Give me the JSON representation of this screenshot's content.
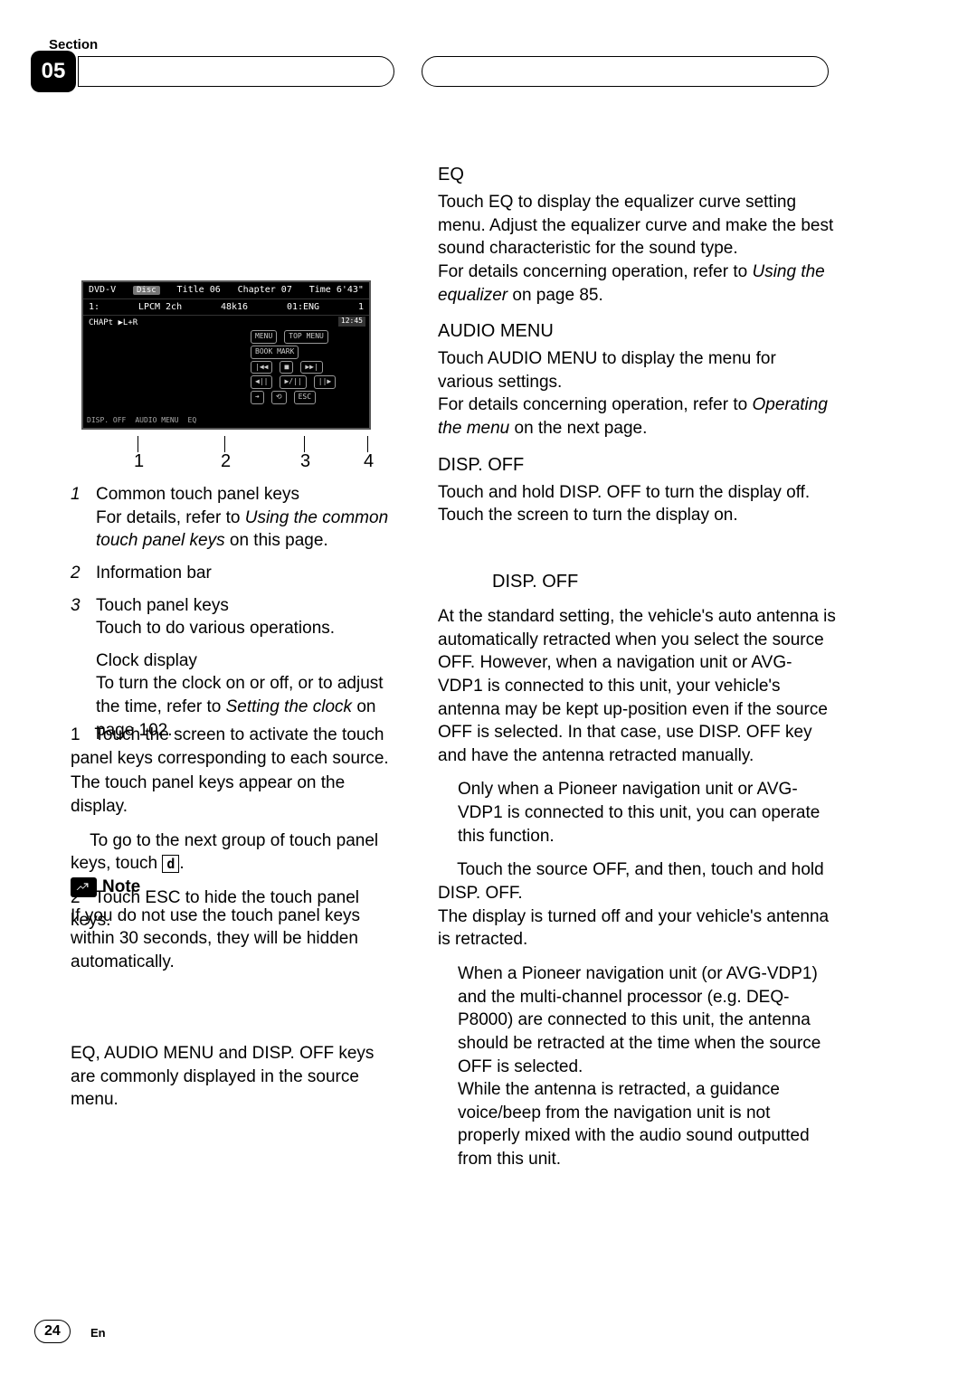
{
  "header": {
    "section_label": "Section",
    "section_number": "05"
  },
  "screenshot": {
    "top": {
      "disc_label": "Disc",
      "title_label": "Title",
      "title_val": "06",
      "chapter_label": "Chapter",
      "chapter_val": "07",
      "time_label": "Time",
      "time_val": "6'43\"",
      "dvd": "DVD-V",
      "audio_icon": "1:",
      "lpcm": "LPCM 2ch",
      "khz": "48k16",
      "sub": "01:ENG",
      "angle": "1"
    },
    "mid_label": "CHAPt ▶L+R",
    "clock": "12:45",
    "buttons": {
      "menu": "MENU",
      "topmenu": "TOP MENU",
      "bookmark": "BOOK MARK",
      "prev": "|◀◀",
      "stop": "■",
      "next": "▶▶|",
      "rew": "◀||",
      "playpause": "▶/||",
      "fwd": "||▶",
      "arrow": "➔",
      "return": "⟲",
      "esc": "ESC"
    },
    "bottom": {
      "disp_off": "DISP. OFF",
      "audio_menu": "AUDIO MENU",
      "eq": "EQ"
    }
  },
  "callouts": {
    "c1": "1",
    "c2": "2",
    "c3": "3",
    "c4": "4"
  },
  "left": {
    "items": [
      {
        "num": "1",
        "lead": "Common touch panel keys",
        "detail_prefix": "For details, refer to ",
        "detail_em": "Using the common touch panel keys",
        "detail_suffix": " on this page."
      },
      {
        "num": "2",
        "lead": "Information bar"
      },
      {
        "num": "3",
        "lead": "Touch panel keys",
        "detail": "Touch to do various operations."
      }
    ],
    "clock_item": {
      "lead": "Clock display",
      "detail_prefix": "To turn the clock on or off, or to adjust the time, refer to ",
      "detail_em": "Setting the clock",
      "detail_suffix": " on page 102."
    },
    "step1": {
      "num": "1",
      "text": "Touch the screen to activate the touch panel keys corresponding to each source."
    },
    "step1_extra": "The touch panel keys appear on the display.",
    "step1_sub_prefix": "To go to the next group of touch panel keys, touch ",
    "step1_sub_key": "d",
    "step1_sub_suffix": ".",
    "step2": {
      "num": "2",
      "text": "Touch ESC to hide the touch panel keys."
    },
    "note_label": "Note",
    "note_text": "If you do not use the touch panel keys within 30 seconds, they will be hidden automatically.",
    "common_keys_text": "EQ, AUDIO MENU and DISP. OFF keys are commonly displayed in the source menu."
  },
  "right": {
    "eq": {
      "title": "EQ",
      "body": "Touch EQ to display the equalizer curve setting menu. Adjust the equalizer curve and make the best sound characteristic for the sound type.",
      "ref_prefix": "For details concerning operation, refer to ",
      "ref_em": "Using the equalizer",
      "ref_suffix": " on page 85."
    },
    "audio_menu": {
      "title": "AUDIO MENU",
      "body": "Touch AUDIO MENU to display the menu for various settings.",
      "ref_prefix": "For details concerning operation, refer to ",
      "ref_em": "Operating the menu",
      "ref_suffix": " on the next page."
    },
    "disp_off": {
      "title": "DISP. OFF",
      "body": "Touch and hold DISP. OFF to turn the display off. Touch the screen to turn the display on."
    },
    "sub_heading": "DISP. OFF",
    "antenna_para": "At the standard setting, the vehicle's auto antenna is automatically retracted when you select the source OFF. However, when a navigation unit or AVG-VDP1 is connected to this unit, your vehicle's antenna may be kept up-position even if the source OFF is selected. In that case, use DISP. OFF key and have the antenna retracted manually.",
    "antenna_bullet": "Only when a Pioneer navigation unit or AVG-VDP1 is connected to this unit, you can operate this function.",
    "touch_off_prefix": "Touch the source OFF, and then, touch and hold DISP. OFF.",
    "touch_off_result": "The display is turned off and your vehicle's antenna is retracted.",
    "final_bullet1": "When a Pioneer navigation unit (or AVG-VDP1) and the multi-channel processor (e.g. DEQ-P8000) are connected to this unit, the antenna should be retracted at the time when the source OFF is selected.",
    "final_bullet2": "While the antenna is retracted, a guidance voice/beep from the navigation unit is not properly mixed with the audio sound outputted from this unit."
  },
  "footer": {
    "page": "24",
    "lang": "En"
  }
}
